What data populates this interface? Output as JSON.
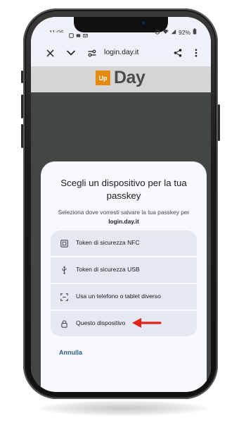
{
  "status_bar": {
    "time": "11:06",
    "battery": "92%"
  },
  "browser": {
    "url": "login.day.it"
  },
  "site": {
    "logo_badge": "Up",
    "logo_name": "Day"
  },
  "sheet": {
    "title": "Scegli un dispositivo per la tua passkey",
    "subtitle": "Seleziona dove vorresti salvare la tua passkey per",
    "domain": "login.day.it",
    "options": [
      {
        "label": "Token di sicurezza NFC",
        "icon": "nfc-icon"
      },
      {
        "label": "Token di sicurezza USB",
        "icon": "usb-icon"
      },
      {
        "label": "Usa un telefono o tablet diverso",
        "icon": "qr-icon"
      },
      {
        "label": "Questo dispositivo",
        "icon": "lock-icon"
      }
    ],
    "cancel_label": "Annulla"
  },
  "colors": {
    "annotation_arrow": "#e0231a",
    "logo_orange": "#e48a10",
    "page_background": "#424744",
    "sheet_background": "#f8f9fe",
    "option_background": "#e5e8f1"
  }
}
